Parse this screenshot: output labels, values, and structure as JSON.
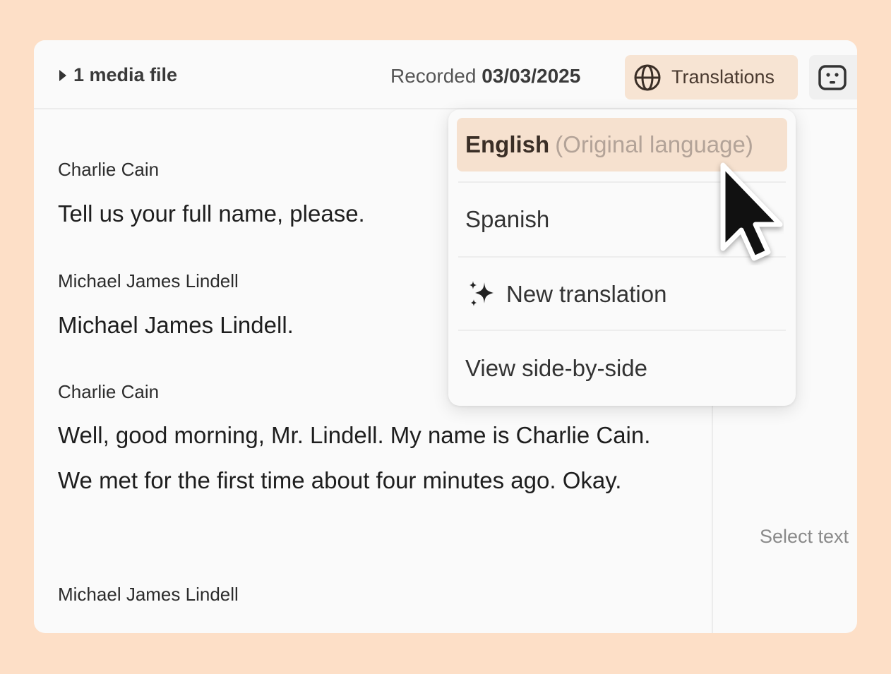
{
  "header": {
    "media_label": "1 media file",
    "recorded_prefix": "Recorded",
    "recorded_date": "03/03/2025",
    "translations_label": "Translations"
  },
  "transcript": [
    {
      "speaker": "Charlie Cain",
      "text": "Tell us your full name, please."
    },
    {
      "speaker": "Michael James Lindell",
      "text": "Michael James Lindell."
    },
    {
      "speaker": "Charlie Cain",
      "text": "Well, good morning, Mr. Lindell. My name is Charlie Cain. We met for the first time about four minutes ago. Okay."
    },
    {
      "speaker": "Michael James Lindell",
      "text": ""
    }
  ],
  "dropdown": {
    "english": "English",
    "english_note": "(Original language)",
    "spanish": "Spanish",
    "new_translation": "New translation",
    "side_by_side": "View side-by-side"
  },
  "side_panel": {
    "hint": "Select text"
  },
  "icons": {
    "media_toggle": "caret-right-icon",
    "translations": "globe-icon",
    "bot": "bot-icon",
    "new_translation": "sparkle-icon",
    "pointer": "mouse-pointer-icon"
  },
  "colors": {
    "background": "#fde0c8",
    "accent": "#f6e1cf"
  }
}
